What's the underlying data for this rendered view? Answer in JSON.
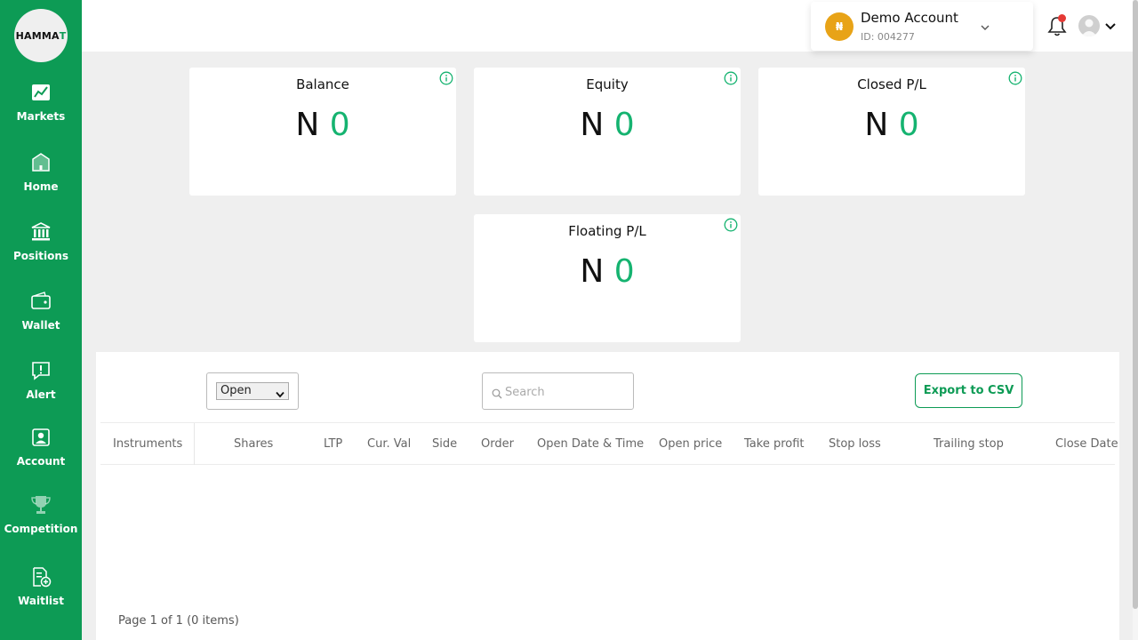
{
  "sidebar": {
    "logo": {
      "main": "HAMMA",
      "accent": "T"
    },
    "items": [
      {
        "label": "Markets",
        "icon": "markets-chart-icon"
      },
      {
        "label": "Home",
        "icon": "home-icon"
      },
      {
        "label": "Positions",
        "icon": "bank-icon"
      },
      {
        "label": "Wallet",
        "icon": "wallet-icon"
      },
      {
        "label": "Alert",
        "icon": "alert-icon"
      },
      {
        "label": "Account",
        "icon": "account-icon"
      },
      {
        "label": "Competition",
        "icon": "trophy-icon"
      },
      {
        "label": "Waitlist",
        "icon": "waitlist-icon"
      }
    ]
  },
  "header": {
    "account": {
      "coin_symbol": "₦",
      "name": "Demo Account",
      "id": "ID: 004277"
    },
    "notifications_unread": true
  },
  "cards": [
    {
      "title": "Balance",
      "currency": "N",
      "value": "0"
    },
    {
      "title": "Equity",
      "currency": "N",
      "value": "0"
    },
    {
      "title": "Closed P/L",
      "currency": "N",
      "value": "0"
    },
    {
      "title": "Floating P/L",
      "currency": "N",
      "value": "0"
    }
  ],
  "table": {
    "filter": {
      "selected": "Open",
      "options": [
        "Open"
      ]
    },
    "search_placeholder": "Search",
    "export_label": "Export to CSV",
    "columns": [
      "Instruments",
      "Shares",
      "LTP",
      "Cur. Val",
      "Side",
      "Order",
      "Open Date & Time",
      "Open price",
      "Take profit",
      "Stop loss",
      "Trailing stop",
      "Close Date"
    ],
    "rows": [],
    "pagination": "Page 1 of 1 (0 items)"
  },
  "colors": {
    "brand": "#0d9b55",
    "value_green": "#15b370",
    "coin": "#e8a317",
    "notification_dot": "#e53935"
  }
}
